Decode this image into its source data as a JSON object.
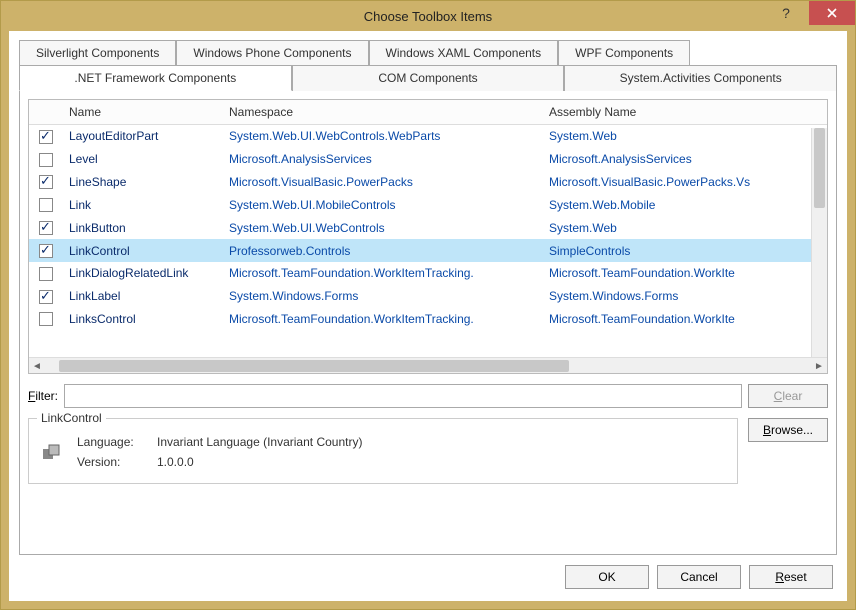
{
  "window": {
    "title": "Choose Toolbox Items"
  },
  "tabs_top": [
    {
      "label": "Silverlight Components"
    },
    {
      "label": "Windows Phone Components"
    },
    {
      "label": "Windows XAML Components"
    },
    {
      "label": "WPF Components"
    }
  ],
  "tabs_bottom": [
    {
      "label": ".NET Framework Components",
      "active": true
    },
    {
      "label": "COM Components"
    },
    {
      "label": "System.Activities Components"
    }
  ],
  "grid": {
    "headers": {
      "name": "Name",
      "namespace": "Namespace",
      "assembly": "Assembly Name"
    },
    "rows": [
      {
        "checked": true,
        "name": "LayoutEditorPart",
        "namespace": "System.Web.UI.WebControls.WebParts",
        "assembly": "System.Web"
      },
      {
        "checked": false,
        "name": "Level",
        "namespace": "Microsoft.AnalysisServices",
        "assembly": "Microsoft.AnalysisServices"
      },
      {
        "checked": true,
        "name": "LineShape",
        "namespace": "Microsoft.VisualBasic.PowerPacks",
        "assembly": "Microsoft.VisualBasic.PowerPacks.Vs"
      },
      {
        "checked": false,
        "name": "Link",
        "namespace": "System.Web.UI.MobileControls",
        "assembly": "System.Web.Mobile"
      },
      {
        "checked": true,
        "name": "LinkButton",
        "namespace": "System.Web.UI.WebControls",
        "assembly": "System.Web"
      },
      {
        "checked": true,
        "name": "LinkControl",
        "namespace": "Professorweb.Controls",
        "assembly": "SimpleControls",
        "selected": true
      },
      {
        "checked": false,
        "name": "LinkDialogRelatedLink",
        "namespace": "Microsoft.TeamFoundation.WorkItemTracking.",
        "assembly": "Microsoft.TeamFoundation.WorkIte"
      },
      {
        "checked": true,
        "name": "LinkLabel",
        "namespace": "System.Windows.Forms",
        "assembly": "System.Windows.Forms"
      },
      {
        "checked": false,
        "name": "LinksControl",
        "namespace": "Microsoft.TeamFoundation.WorkItemTracking.",
        "assembly": "Microsoft.TeamFoundation.WorkIte"
      }
    ]
  },
  "filter": {
    "label": "Filter:",
    "value": ""
  },
  "buttons": {
    "clear": "Clear",
    "browse": "Browse...",
    "ok": "OK",
    "cancel": "Cancel",
    "reset": "Reset"
  },
  "details": {
    "legend": "LinkControl",
    "language_label": "Language:",
    "language_value": "Invariant Language (Invariant Country)",
    "version_label": "Version:",
    "version_value": "1.0.0.0"
  }
}
